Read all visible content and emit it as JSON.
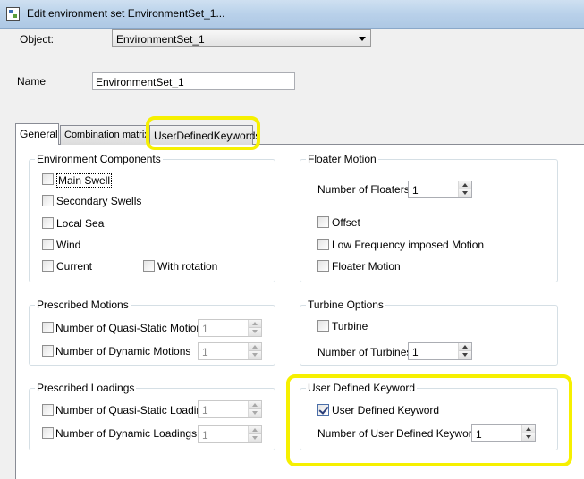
{
  "window": {
    "title": "Edit environment set EnvironmentSet_1..."
  },
  "object": {
    "label": "Object:",
    "selected": "EnvironmentSet_1"
  },
  "name": {
    "label": "Name",
    "value": "EnvironmentSet_1"
  },
  "tabs": [
    {
      "label": "General"
    },
    {
      "label": "Combination matrix"
    },
    {
      "label": "UserDefinedKeywords"
    }
  ],
  "environment_components": {
    "title": "Environment Components",
    "main_swell": "Main Swell",
    "secondary_swells": "Secondary Swells",
    "local_sea": "Local Sea",
    "wind": "Wind",
    "current": "Current",
    "with_rotation": "With rotation"
  },
  "floater_motion": {
    "title": "Floater Motion",
    "num_floaters_label": "Number of Floaters",
    "num_floaters_value": "1",
    "offset": "Offset",
    "low_freq": "Low Frequency imposed Motion",
    "floater_motion": "Floater Motion"
  },
  "prescribed_motions": {
    "title": "Prescribed Motions",
    "quasi_static_label": "Number of Quasi-Static Motions",
    "quasi_static_value": "1",
    "dynamic_label": "Number of Dynamic Motions",
    "dynamic_value": "1"
  },
  "turbine_options": {
    "title": "Turbine Options",
    "turbine": "Turbine",
    "num_turbines_label": "Number of Turbines",
    "num_turbines_value": "1"
  },
  "prescribed_loadings": {
    "title": "Prescribed Loadings",
    "quasi_static_label": "Number of Quasi-Static Loadings",
    "quasi_static_value": "1",
    "dynamic_label": "Number of Dynamic Loadings",
    "dynamic_value": "1"
  },
  "user_defined_keyword": {
    "title": "User Defined Keyword",
    "checkbox_label": "User Defined Keyword",
    "checked": true,
    "num_label": "Number of User Defined Keywords",
    "num_value": "1"
  },
  "colors": {
    "highlight": "#f6f000",
    "titlebar": "#b9d1ea"
  },
  "icons": [
    "app-icon",
    "chevron-down-icon",
    "spin-up-icon",
    "spin-down-icon",
    "checkmark-icon"
  ]
}
